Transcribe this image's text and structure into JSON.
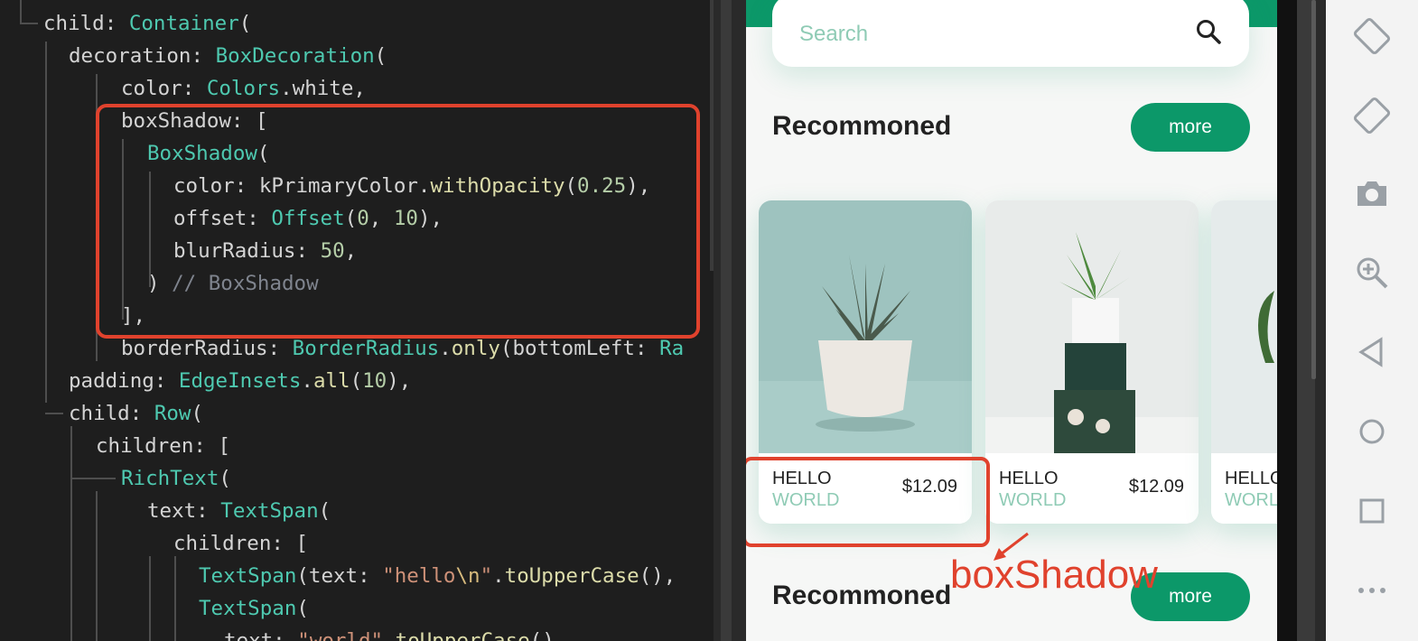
{
  "editor": {
    "lines": [
      "child: Container(",
      "decoration: BoxDecoration(",
      "color: Colors.white,",
      "boxShadow: [",
      "BoxShadow(",
      "color: kPrimaryColor.withOpacity(0.25),",
      "offset: Offset(0, 10),",
      "blurRadius: 50,",
      ") // BoxShadow",
      "],",
      "borderRadius: BorderRadius.only(bottomLeft: Ra",
      "padding: EdgeInsets.all(10),",
      "child: Row(",
      "children: [",
      "RichText(",
      "text: TextSpan(",
      "children: [",
      "TextSpan(text: \"hello\\n\".toUpperCase(),",
      "TextSpan(",
      "text: \"world\".toUpperCase(),"
    ]
  },
  "app": {
    "search_placeholder": "Search",
    "section1_title": "Recommoned",
    "section2_title": "Recommoned",
    "more_label": "more",
    "cards": [
      {
        "name": "HELLO",
        "sub": "WORLD",
        "price": "$12.09"
      },
      {
        "name": "HELLO",
        "sub": "WORLD",
        "price": "$12.09"
      },
      {
        "name": "HELLO",
        "sub": "WORLD"
      }
    ],
    "annotation": "boxShadow"
  },
  "colors": {
    "primary": "#0c9869",
    "annotation": "#e0422d",
    "editor_bg": "#1e1e1e"
  },
  "toolbar": {
    "icons": [
      "rotate-left-icon",
      "rotate-right-icon",
      "camera-icon",
      "zoom-in-icon",
      "back-icon",
      "home-icon",
      "overview-icon",
      "more-icon"
    ]
  }
}
